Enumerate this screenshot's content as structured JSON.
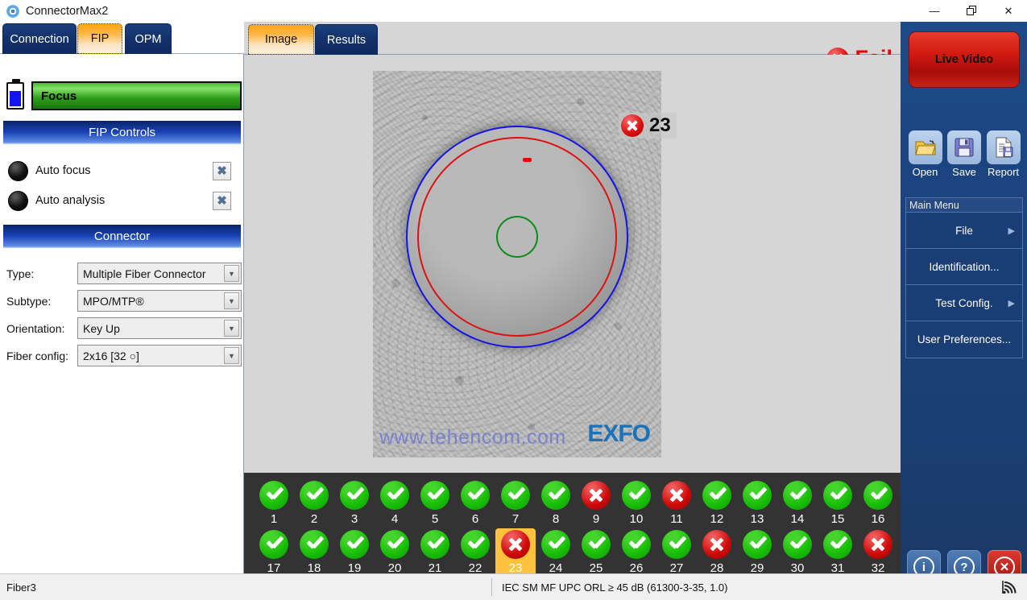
{
  "window": {
    "title": "ConnectorMax2",
    "icon": "app-circle-icon",
    "controls": {
      "minimize": "—",
      "restore": "❐",
      "close": "✕"
    }
  },
  "left_panel": {
    "tabs": [
      {
        "label": "Connection",
        "active": false
      },
      {
        "label": "FIP",
        "active": true
      },
      {
        "label": "OPM",
        "active": false
      }
    ],
    "focus": {
      "label": "Focus",
      "battery_icon": "battery-icon"
    },
    "fip_controls": {
      "header": "FIP Controls",
      "items": [
        {
          "label": "Auto focus",
          "led": "led-off-icon",
          "close": "✖"
        },
        {
          "label": "Auto analysis",
          "led": "led-off-icon",
          "close": "✖"
        }
      ]
    },
    "connector": {
      "header": "Connector",
      "fields": [
        {
          "label": "Type:",
          "value": "Multiple Fiber Connector"
        },
        {
          "label": "Subtype:",
          "value": "MPO/MTP®"
        },
        {
          "label": "Orientation:",
          "value": "Key Up"
        },
        {
          "label": "Fiber config:",
          "value": "2x16  [32 ○]"
        }
      ]
    }
  },
  "center": {
    "tabs": [
      {
        "label": "Image",
        "active": true
      },
      {
        "label": "Results",
        "active": false
      }
    ],
    "verdict": {
      "text": "Fail",
      "icon": "fail-x-icon",
      "color": "#ef0000"
    },
    "image": {
      "badge_number": "23",
      "badge_icon": "fail-x-icon",
      "watermark": "www.tehencom.com",
      "logo": "EXFO"
    },
    "fiber_grid": {
      "row1": [
        {
          "n": "1",
          "status": "pass",
          "selected": false
        },
        {
          "n": "2",
          "status": "pass",
          "selected": false
        },
        {
          "n": "3",
          "status": "pass",
          "selected": false
        },
        {
          "n": "4",
          "status": "pass",
          "selected": false
        },
        {
          "n": "5",
          "status": "pass",
          "selected": false
        },
        {
          "n": "6",
          "status": "pass",
          "selected": false
        },
        {
          "n": "7",
          "status": "pass",
          "selected": false
        },
        {
          "n": "8",
          "status": "pass",
          "selected": false
        },
        {
          "n": "9",
          "status": "fail",
          "selected": false
        },
        {
          "n": "10",
          "status": "pass",
          "selected": false
        },
        {
          "n": "11",
          "status": "fail",
          "selected": false
        },
        {
          "n": "12",
          "status": "pass",
          "selected": false
        },
        {
          "n": "13",
          "status": "pass",
          "selected": false
        },
        {
          "n": "14",
          "status": "pass",
          "selected": false
        },
        {
          "n": "15",
          "status": "pass",
          "selected": false
        },
        {
          "n": "16",
          "status": "pass",
          "selected": false
        }
      ],
      "row2": [
        {
          "n": "17",
          "status": "pass",
          "selected": false
        },
        {
          "n": "18",
          "status": "pass",
          "selected": false
        },
        {
          "n": "19",
          "status": "pass",
          "selected": false
        },
        {
          "n": "20",
          "status": "pass",
          "selected": false
        },
        {
          "n": "21",
          "status": "pass",
          "selected": false
        },
        {
          "n": "22",
          "status": "pass",
          "selected": false
        },
        {
          "n": "23",
          "status": "fail",
          "selected": true
        },
        {
          "n": "24",
          "status": "pass",
          "selected": false
        },
        {
          "n": "25",
          "status": "pass",
          "selected": false
        },
        {
          "n": "26",
          "status": "pass",
          "selected": false
        },
        {
          "n": "27",
          "status": "pass",
          "selected": false
        },
        {
          "n": "28",
          "status": "fail",
          "selected": false
        },
        {
          "n": "29",
          "status": "pass",
          "selected": false
        },
        {
          "n": "30",
          "status": "pass",
          "selected": false
        },
        {
          "n": "31",
          "status": "pass",
          "selected": false
        },
        {
          "n": "32",
          "status": "fail",
          "selected": false
        }
      ]
    }
  },
  "right_panel": {
    "live_video": "Live Video",
    "tools": [
      {
        "label": "Open",
        "icon": "open-folder-icon"
      },
      {
        "label": "Save",
        "icon": "floppy-disk-icon"
      },
      {
        "label": "Report",
        "icon": "report-document-icon"
      }
    ],
    "main_menu": {
      "header": "Main Menu",
      "items": [
        {
          "label": "File",
          "caret": "▶"
        },
        {
          "label": "Identification...",
          "caret": ""
        },
        {
          "label": "Test Config.",
          "caret": "▶"
        },
        {
          "label": "User Preferences...",
          "caret": ""
        }
      ]
    },
    "bottom_buttons": [
      {
        "name": "info",
        "glyph": "i"
      },
      {
        "name": "help",
        "glyph": "?"
      },
      {
        "name": "close",
        "glyph": "✕"
      }
    ]
  },
  "status_bar": {
    "left": "Fiber3",
    "middle": "IEC SM MF UPC ORL ≥ 45 dB (61300-3-35, 1.0)",
    "icon": "signal-icon"
  }
}
